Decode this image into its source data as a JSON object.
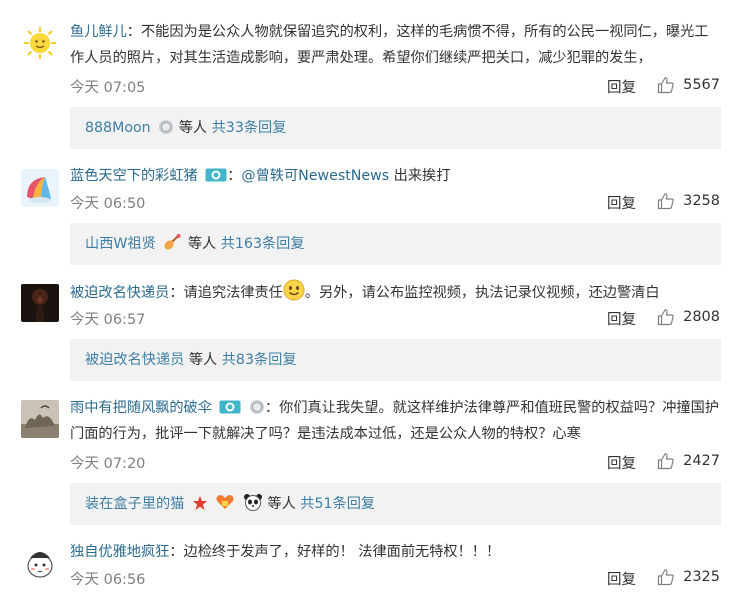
{
  "comments": [
    {
      "user": "鱼儿鲜儿",
      "sep": "：",
      "content": "不能因为是公众人物就保留追究的权利，这样的毛病惯不得，所有的公民一视同仁，曝光工作人员的照片，对其生活造成影响，要严肃处理。希望你们继续严把关口，减少犯罪的发生，",
      "time": "今天 07:05",
      "reply": "回复",
      "likes": "5567",
      "sub_user": "888Moon",
      "sub_mid": " 等人 ",
      "sub_count": "共33条回复"
    },
    {
      "user": "蓝色天空下的彩虹猪",
      "sep": "：",
      "mention": "@曾轶可NewestNews",
      "content": " 出来挨打",
      "time": "今天 06:50",
      "reply": "回复",
      "likes": "3258",
      "sub_user": "山西W祖贤",
      "sub_mid": " 等人 ",
      "sub_count": "共163条回复"
    },
    {
      "user": "被迫改名快递员",
      "sep": "：",
      "content_a": "请追究法律责任",
      "content_b": "。另外，请公布监控视频，执法记录仪视频，还边警清白",
      "time": "今天 06:57",
      "reply": "回复",
      "likes": "2808",
      "sub_user": "被迫改名快递员",
      "sub_mid": " 等人 ",
      "sub_count": "共83条回复"
    },
    {
      "user": "雨中有把随风飘的破伞",
      "sep": "：",
      "content": "你们真让我失望。就这样维护法律尊严和值班民警的权益吗？冲撞国护门面的行为，批评一下就解决了吗？是违法成本过低，还是公众人物的特权？心寒",
      "time": "今天 07:20",
      "reply": "回复",
      "likes": "2427",
      "sub_user": "装在盒子里的猫",
      "sub_mid": " 等人 ",
      "sub_count": "共51条回复"
    },
    {
      "user": "独自优雅地疯狂",
      "sep": "：",
      "content": "边检终于发声了，好样的！ 法律面前无特权！！！",
      "time": "今天 06:56",
      "reply": "回复",
      "likes": "2325"
    }
  ]
}
